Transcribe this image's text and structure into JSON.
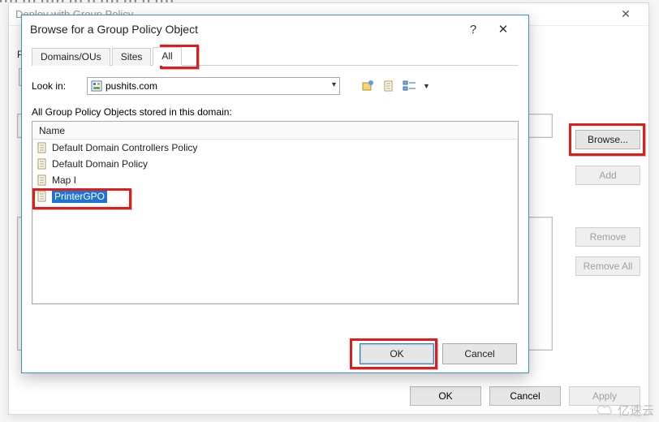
{
  "parent_dialog": {
    "title": "Deploy with Group Policy",
    "p_label": "P",
    "buttons": {
      "browse": "Browse...",
      "add": "Add",
      "remove": "Remove",
      "remove_all": "Remove All",
      "ok": "OK",
      "cancel": "Cancel",
      "apply": "Apply"
    }
  },
  "browse_dialog": {
    "title": "Browse for a Group Policy Object",
    "help_symbol": "?",
    "close_symbol": "✕",
    "tabs": {
      "domains": "Domains/OUs",
      "sites": "Sites",
      "all": "All"
    },
    "lookin_label": "Look in:",
    "lookin_value": "pushits.com",
    "list_label": "All Group Policy Objects stored in this domain:",
    "header_name": "Name",
    "items": [
      "Default Domain Controllers Policy",
      "Default Domain Policy",
      "Map I",
      "PrinterGPO"
    ],
    "ok": "OK",
    "cancel": "Cancel"
  },
  "watermark": "亿速云"
}
